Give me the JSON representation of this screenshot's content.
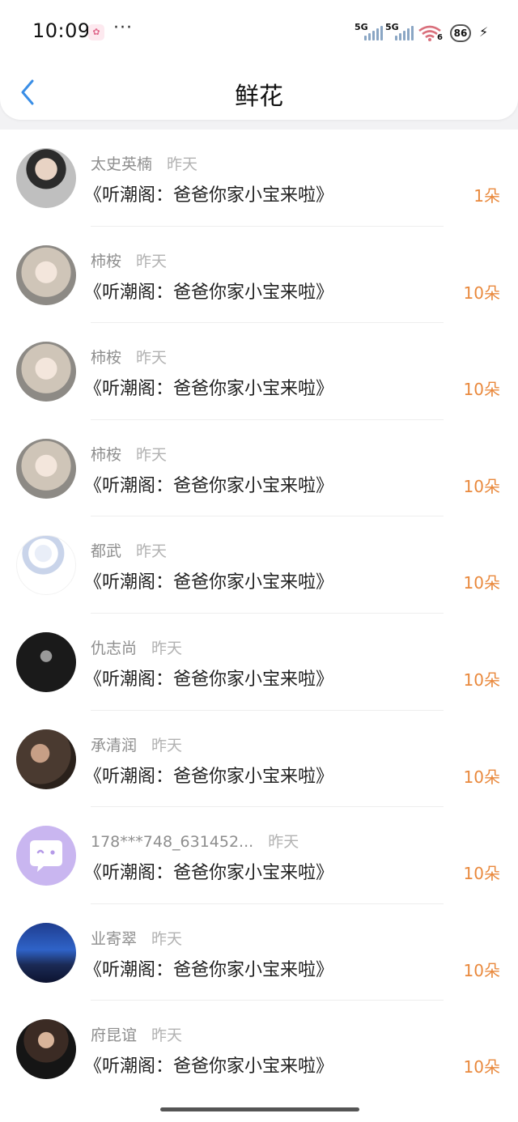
{
  "status_bar": {
    "time": "10:09",
    "app_icon_glyph": "✿",
    "more": "···",
    "signal1_label": "5G",
    "signal2_label": "5G",
    "wifi_label": "6",
    "battery_level": "86"
  },
  "header": {
    "title": "鲜花",
    "back_icon": "chevron-left-icon",
    "accent_color": "#3a8ee6"
  },
  "items": [
    {
      "name": "太史英楠",
      "date": "昨天",
      "work": "《听潮阁：爸爸你家小宝来啦》",
      "count": "1朵",
      "avatar": "man-glasses"
    },
    {
      "name": "柿桉",
      "date": "昨天",
      "work": "《听潮阁：爸爸你家小宝来啦》",
      "count": "10朵",
      "avatar": "anime-girl"
    },
    {
      "name": "柿桉",
      "date": "昨天",
      "work": "《听潮阁：爸爸你家小宝来啦》",
      "count": "10朵",
      "avatar": "anime-girl"
    },
    {
      "name": "柿桉",
      "date": "昨天",
      "work": "《听潮阁：爸爸你家小宝来啦》",
      "count": "10朵",
      "avatar": "anime-girl"
    },
    {
      "name": "都武",
      "date": "昨天",
      "work": "《听潮阁：爸爸你家小宝来啦》",
      "count": "10朵",
      "avatar": "porcelain-figure"
    },
    {
      "name": "仇志尚",
      "date": "昨天",
      "work": "《听潮阁：爸爸你家小宝来啦》",
      "count": "10朵",
      "avatar": "dark-portrait"
    },
    {
      "name": "承清润",
      "date": "昨天",
      "work": "《听潮阁：爸爸你家小宝来啦》",
      "count": "10朵",
      "avatar": "man-portrait"
    },
    {
      "name": "178***748_631452...",
      "date": "昨天",
      "work": "《听潮阁：爸爸你家小宝来啦》",
      "count": "10朵",
      "avatar": "default-chat"
    },
    {
      "name": "业寄翠",
      "date": "昨天",
      "work": "《听潮阁：爸爸你家小宝来啦》",
      "count": "10朵",
      "avatar": "city-night"
    },
    {
      "name": "府昆谊",
      "date": "昨天",
      "work": "《听潮阁：爸爸你家小宝来啦》",
      "count": "10朵",
      "avatar": "woman-dark"
    }
  ]
}
